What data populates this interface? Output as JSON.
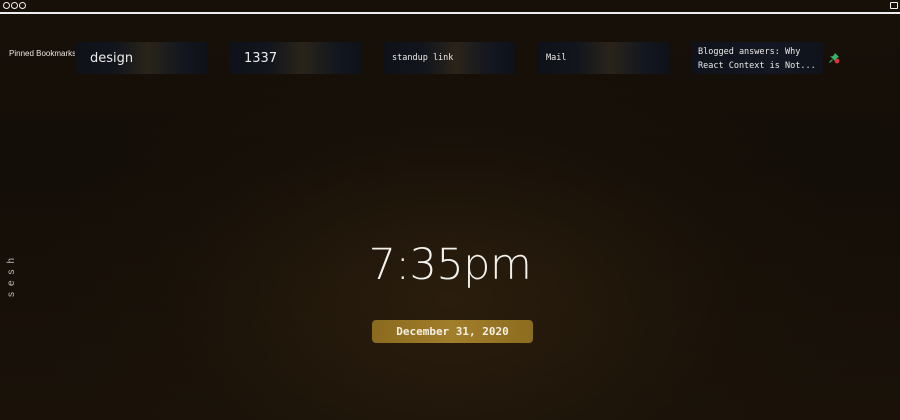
{
  "header": {
    "pinned_label": "Pinned Bookmarks"
  },
  "bookmarks": [
    {
      "label": "design"
    },
    {
      "label": "1337"
    },
    {
      "label": "standup link"
    },
    {
      "label": "Mail"
    },
    {
      "label": "Blogged answers: Why React Context is Not..."
    }
  ],
  "icons": {
    "pin": "pin-icon",
    "window_controls": [
      "dot-icon",
      "dot-icon",
      "dot-icon",
      "window-button-icon"
    ]
  },
  "sidebar": {
    "label": "sesh"
  },
  "clock": {
    "time": "7:35pm",
    "date": "December 31, 2020"
  },
  "colors": {
    "accent": "#a17e2a",
    "background": "#120d07"
  }
}
